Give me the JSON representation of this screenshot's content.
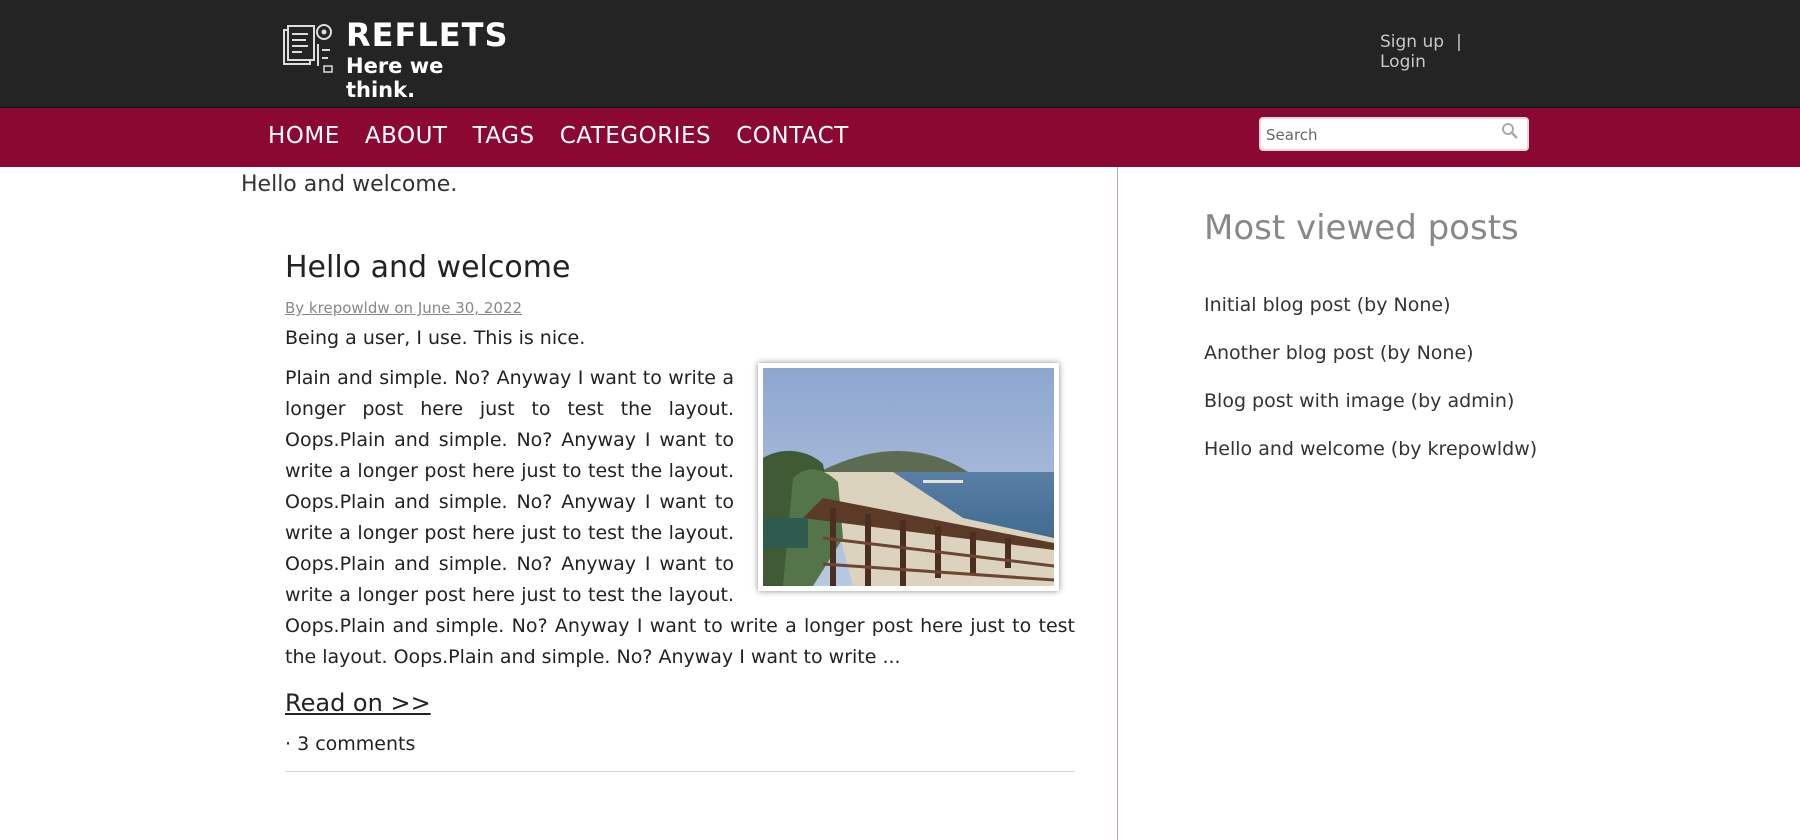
{
  "header": {
    "logo_title": "REFLETS",
    "logo_tagline": "Here we think.",
    "signup_label": "Sign up",
    "separator": "|",
    "login_label": "Login"
  },
  "nav": {
    "items": [
      "HOME",
      "ABOUT",
      "TAGS",
      "CATEGORIES",
      "CONTACT"
    ],
    "search_placeholder": "Search"
  },
  "main": {
    "intro": "Hello and welcome.",
    "post": {
      "title": "Hello and welcome",
      "meta": "By krepowldw on June 30, 2022",
      "lead": "Being a user, I use. This is nice.",
      "body": "Plain and simple. No? Anyway I want to write a longer post here just to test the layout. Oops.Plain and simple. No? Anyway I want to write a longer post here just to test the layout. Oops.Plain and simple. No? Anyway I want to write a longer post here just to test the layout. Oops.Plain and simple. No? Anyway I want to write a longer post here just to test the layout. Oops.Plain and simple. No? Anyway I want to write a longer post here just to test the layout. Oops.Plain and simple. No? Anyway I want to write ...",
      "image_icon": "beach-photo",
      "read_on": "Read on >>",
      "comments": "· 3 comments"
    }
  },
  "sidebar": {
    "title": "Most viewed posts",
    "items": [
      "Initial blog post (by None)",
      "Another blog post (by None)",
      "Blog post with image (by admin)",
      "Hello and welcome (by krepowldw)"
    ]
  },
  "colors": {
    "header_bg": "#242424",
    "nav_bg": "#8b0833",
    "text": "#222222",
    "muted": "#888888"
  }
}
